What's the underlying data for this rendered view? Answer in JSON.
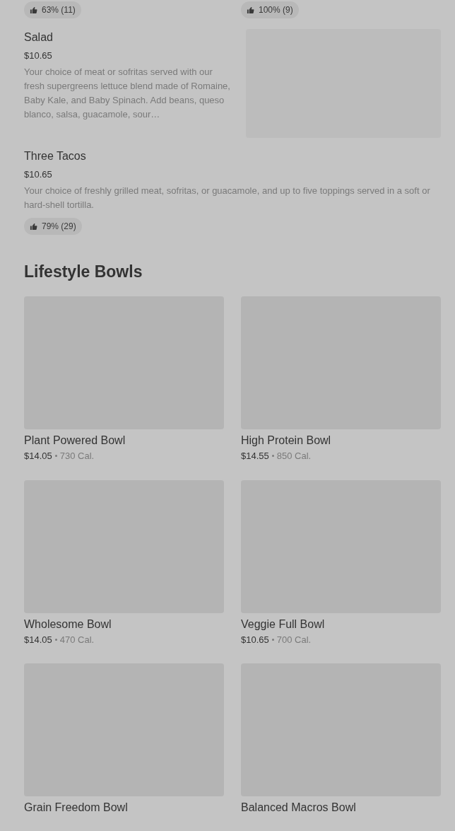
{
  "top_ratings": [
    "63% (11)",
    "100% (9)"
  ],
  "items": [
    {
      "name": "Salad",
      "price": "$10.65",
      "description": "Your choice of meat or sofritas served with our fresh supergreens lettuce blend made of Romaine, Baby Kale, and Baby Spinach. Add beans, queso blanco, salsa, guacamole, sour…",
      "has_image": true
    },
    {
      "name": "Three Tacos",
      "price": "$10.65",
      "description": "Your choice of freshly grilled meat, sofritas, or guacamole, and up to five toppings served in a soft or hard-shell tortilla.",
      "rating": "79% (29)",
      "has_image": false
    }
  ],
  "section": {
    "title": "Lifestyle Bowls",
    "bowls": [
      {
        "name": "Plant Powered Bowl",
        "price": "$14.05",
        "calories": "730 Cal."
      },
      {
        "name": "High Protein Bowl",
        "price": "$14.55",
        "calories": "850 Cal."
      },
      {
        "name": "Wholesome Bowl",
        "price": "$14.05",
        "calories": "470 Cal."
      },
      {
        "name": "Veggie Full Bowl",
        "price": "$10.65",
        "calories": "700 Cal."
      },
      {
        "name": "Grain Freedom Bowl"
      },
      {
        "name": "Balanced Macros Bowl"
      }
    ]
  }
}
